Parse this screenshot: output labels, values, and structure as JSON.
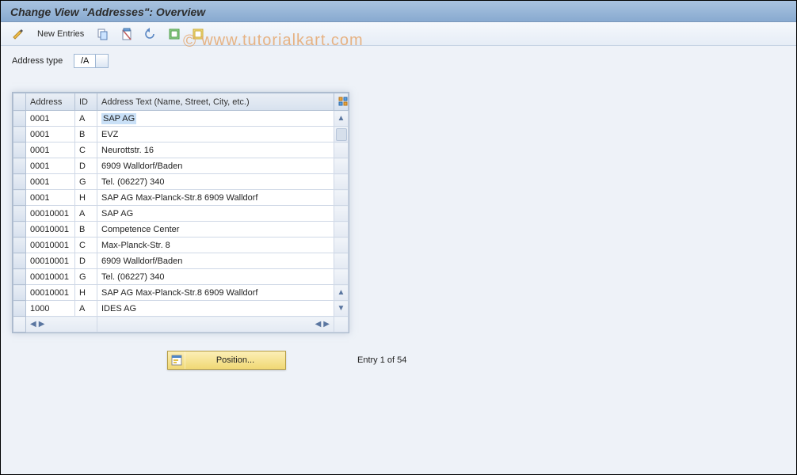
{
  "title": "Change View \"Addresses\": Overview",
  "toolbar": {
    "new_entries_label": "New Entries"
  },
  "field": {
    "label": "Address type",
    "value": "/A"
  },
  "columns": {
    "address": "Address",
    "id": "ID",
    "text": "Address Text (Name, Street, City, etc.)"
  },
  "rows": [
    {
      "address": "0001",
      "id": "A",
      "text": "SAP AG",
      "highlight": true
    },
    {
      "address": "0001",
      "id": "B",
      "text": "EVZ"
    },
    {
      "address": "0001",
      "id": "C",
      "text": "Neurottstr. 16"
    },
    {
      "address": "0001",
      "id": "D",
      "text": "6909   Walldorf/Baden"
    },
    {
      "address": "0001",
      "id": "G",
      "text": "Tel. (06227) 340"
    },
    {
      "address": "0001",
      "id": "H",
      "text": "SAP AG Max-Planck-Str.8 6909 Walldorf"
    },
    {
      "address": "00010001",
      "id": "A",
      "text": "SAP AG"
    },
    {
      "address": "00010001",
      "id": "B",
      "text": "Competence Center"
    },
    {
      "address": "00010001",
      "id": "C",
      "text": "Max-Planck-Str. 8"
    },
    {
      "address": "00010001",
      "id": "D",
      "text": "6909   Walldorf/Baden"
    },
    {
      "address": "00010001",
      "id": "G",
      "text": "Tel. (06227) 340"
    },
    {
      "address": "00010001",
      "id": "H",
      "text": "SAP AG Max-Planck-Str.8 6909 Walldorf"
    },
    {
      "address": "1000",
      "id": "A",
      "text": "IDES AG"
    }
  ],
  "position_button": "Position...",
  "entry_info": "Entry 1 of 54",
  "watermark": "www.tutorialkart.com"
}
